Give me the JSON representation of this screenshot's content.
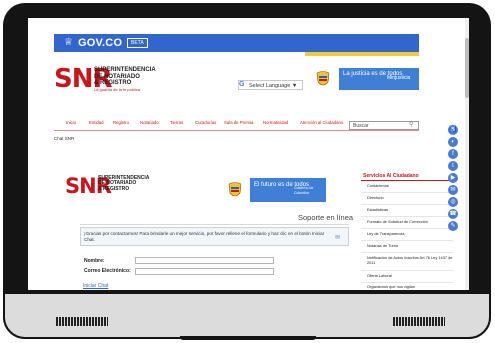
{
  "govbar": {
    "logo": "GOV.CO",
    "beta": "BETA"
  },
  "header": {
    "snr": "SNR",
    "lines": [
      "SUPERINTENDENCIA",
      "DE NOTARIADO",
      "& REGISTRO"
    ],
    "tagline": "La guarda de la fe pública",
    "language_select": "Select Language",
    "justicia_text": "La justicia es de todos",
    "justicia_ministry": "Minjusticia"
  },
  "nav": {
    "items": [
      "Inicio",
      "Entidad",
      "Registro",
      "Notariado",
      "Tierras",
      "Curadurías",
      "Sala de Prensa",
      "Normatividad",
      "Atención al Ciudadano"
    ],
    "search_placeholder": "Buscar"
  },
  "breadcrumb": "Chat SNR",
  "chat": {
    "futuro_text": "El futuro es de todos",
    "futuro_sub": "Gobierno de Colombia",
    "support_title": "Soporte en línea",
    "message": "¡Gracias por contactarnos! Para brindarle un mejor servicio, por favor rellene el formulario y haz clic en el botón Iniciar Chat.",
    "name_label": "Nombre:",
    "email_label": "Correo Electrónico:",
    "start_link": "Iniciar Chat"
  },
  "sidebar": {
    "title": "Servicios Al Ciudadano",
    "items": [
      "Contáctenos",
      "Directorio",
      "Estadísticas",
      "Formato de Solicitud de Corrección",
      "Ley de Transparencia",
      "Notarías de Turno",
      "Notificación de Actos Inscritos Art.76 Ley 1437 de 2011",
      "Oferta Laboral",
      "Organismos que nos vigilan"
    ]
  },
  "social_icons": [
    "accessibility-icon",
    "contrast-icon",
    "facebook-icon",
    "twitter-icon",
    "youtube-icon",
    "email-icon",
    "instagram-icon",
    "whatsapp-icon",
    "chat-icon"
  ],
  "colors": {
    "brand_red": "#c8161d",
    "gov_blue": "#3366cc",
    "justicia_blue": "#3f7fd6",
    "gov_yellow": "#f3c93e"
  }
}
